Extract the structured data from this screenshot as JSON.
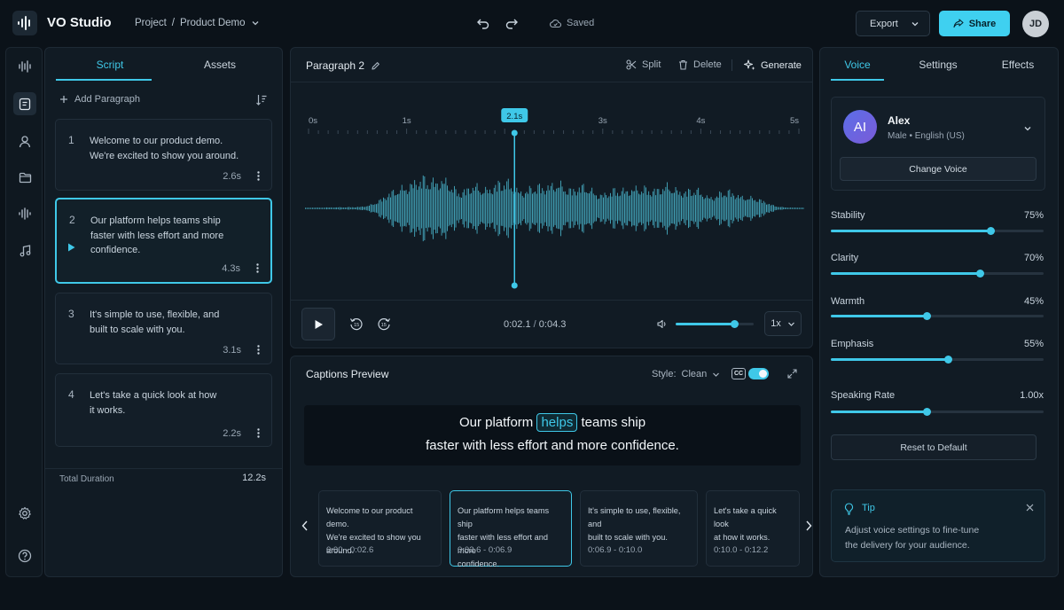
{
  "app": {
    "title": "VO Studio",
    "breadcrumb": {
      "project": "Project",
      "separator": "/",
      "page": "Product Demo"
    },
    "saved_label": "Saved",
    "export_label": "Export",
    "share_label": "Share",
    "user_initials": "JD",
    "accent_color": "#3fc8e8"
  },
  "script_panel": {
    "tabs": [
      {
        "label": "Script",
        "active": true
      },
      {
        "label": "Assets",
        "active": false
      }
    ],
    "add_paragraph_label": "Add Paragraph",
    "paragraphs": [
      {
        "number": "1",
        "line1": "Welcome to our product demo.",
        "line2": "We're excited to show you around.",
        "line3": "",
        "duration": "2.6s"
      },
      {
        "number": "2",
        "line1": "Our platform helps teams ship",
        "line2": "faster with less effort and more",
        "line3": "confidence.",
        "duration": "4.3s"
      },
      {
        "number": "3",
        "line1": "It's simple to use, flexible, and",
        "line2": "built to scale with you.",
        "line3": "",
        "duration": "3.1s"
      },
      {
        "number": "4",
        "line1": "Let's take a quick look at how",
        "line2": "it works.",
        "line3": "",
        "duration": "2.2s"
      }
    ],
    "total_label": "Total Duration",
    "total_value": "12.2s"
  },
  "editor": {
    "paragraph_title": "Paragraph 2",
    "split_label": "Split",
    "delete_label": "Delete",
    "generate_label": "Generate",
    "ruler_labels": [
      "0s",
      "1s",
      "2.1s",
      "3s",
      "4s",
      "5s"
    ],
    "playhead_label": "2.1s",
    "playhead_seconds": 2.1,
    "timeline_seconds": 5,
    "current_time": "0:02.1",
    "time_separator": "/",
    "total_time": "0:04.3",
    "volume_level": 0.75,
    "speed": "1x"
  },
  "captions": {
    "title": "Captions Preview",
    "style_label": "Style:",
    "style_value": "Clean",
    "cc_label": "CC",
    "cc_enabled": true,
    "preview_line1_before": "Our platform",
    "preview_highlight": "helps",
    "preview_line1_after": "teams ship",
    "preview_line2": "faster with less effort and more confidence.",
    "segments": [
      {
        "line1": "Welcome to our product demo.",
        "line2": "We're excited to show you around.",
        "line3": "",
        "time": "0:00 - 0:02.6",
        "active": false
      },
      {
        "line1": "Our platform helps teams ship",
        "line2": "faster with less effort and more",
        "line3": "confidence.",
        "time": "0:02.6 - 0:06.9",
        "active": true
      },
      {
        "line1": "It's simple to use, flexible, and",
        "line2": "built to scale with you.",
        "line3": "",
        "time": "0:06.9 - 0:10.0",
        "active": false
      },
      {
        "line1": "Let's take a quick look",
        "line2": "at how it works.",
        "line3": "",
        "time": "0:10.0 - 0:12.2",
        "active": false
      }
    ]
  },
  "voice_panel": {
    "tabs": [
      {
        "label": "Voice",
        "active": true
      },
      {
        "label": "Settings",
        "active": false
      },
      {
        "label": "Effects",
        "active": false
      }
    ],
    "voice": {
      "initials": "AI",
      "name": "Alex",
      "meta": "Male • English (US)"
    },
    "change_voice_label": "Change Voice",
    "sliders": [
      {
        "label": "Stability",
        "value": "75%",
        "level": 0.75
      },
      {
        "label": "Clarity",
        "value": "70%",
        "level": 0.7
      },
      {
        "label": "Warmth",
        "value": "45%",
        "level": 0.45
      },
      {
        "label": "Emphasis",
        "value": "55%",
        "level": 0.55
      },
      {
        "label": "Speaking Rate",
        "value": "1.00x",
        "level": 0.45
      }
    ],
    "reset_label": "Reset to Default",
    "tip": {
      "title": "Tip",
      "line1": "Adjust voice settings to fine-tune",
      "line2": "the delivery for your audience."
    }
  }
}
